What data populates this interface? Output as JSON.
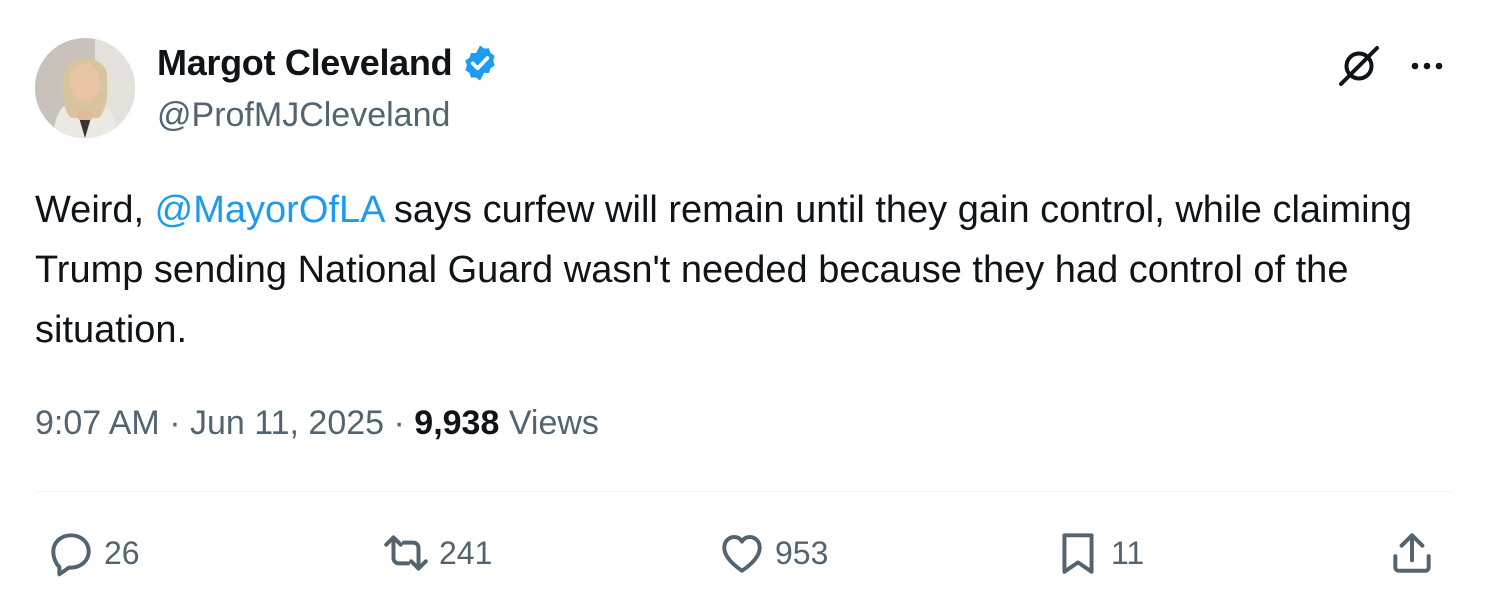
{
  "author": {
    "display_name": "Margot Cleveland",
    "handle": "@ProfMJCleveland",
    "avatar_icon": "profile-photo",
    "verified_icon": "verified-badge-icon",
    "verified_color": "#1d9bf0"
  },
  "tweet": {
    "text_before": "Weird, ",
    "mention": "@MayorOfLA",
    "text_after": " says curfew will remain until they gain control, while claiming Trump sending National Guard wasn't needed because they had control of the situation."
  },
  "meta": {
    "time": "9:07 AM",
    "sep1": " · ",
    "date": "Jun 11, 2025",
    "sep2": " · ",
    "views_count": "9,938",
    "views_label": " Views"
  },
  "actions": {
    "replies": "26",
    "reposts": "241",
    "likes": "953",
    "bookmarks": "11"
  },
  "icons": [
    "grok-icon",
    "more-icon",
    "reply-icon",
    "repost-icon",
    "like-icon",
    "bookmark-icon",
    "share-icon"
  ],
  "colors": {
    "accent": "#1d9bf0",
    "text": "#0f1419",
    "secondary": "#536471"
  }
}
